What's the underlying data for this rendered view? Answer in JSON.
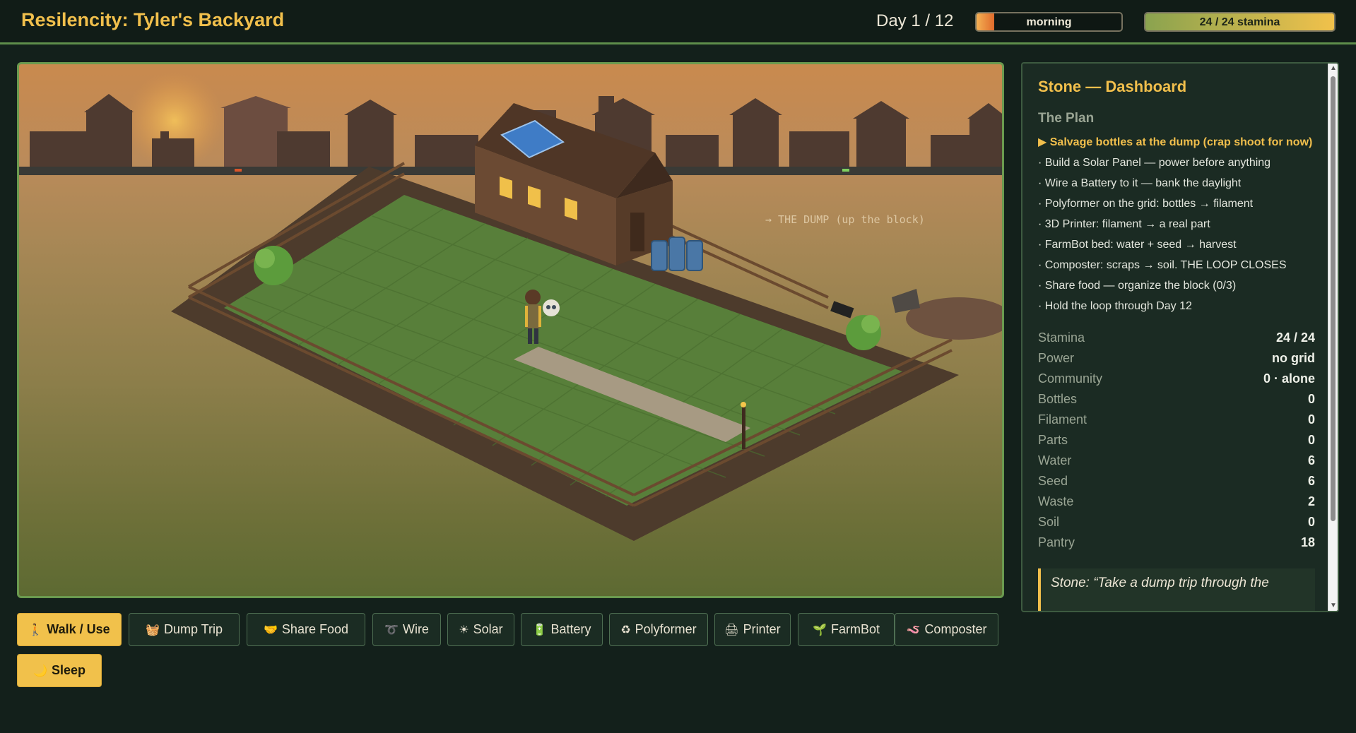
{
  "header": {
    "title": "Resilencity: Tyler's Backyard",
    "day": "Day 1 / 12",
    "time_of_day": {
      "label": "morning",
      "progress": 0.12
    },
    "stamina": {
      "label": "24 / 24 stamina",
      "progress": 1.0
    }
  },
  "scene": {
    "dump_label": "→ THE DUMP (up the block)"
  },
  "dashboard": {
    "title": "Stone — Dashboard",
    "plan_title": "The Plan",
    "plan_items": [
      {
        "text": "▶ Salvage bottles at the dump (crap shoot for now)",
        "active": true
      },
      {
        "text": "· Build a Solar Panel — power before anything",
        "active": false
      },
      {
        "text": "· Wire a Battery to it — bank the daylight",
        "active": false
      },
      {
        "text": "· Polyformer on the grid: bottles → filament",
        "active": false
      },
      {
        "text": "· 3D Printer: filament → a real part",
        "active": false
      },
      {
        "text": "· FarmBot bed: water + seed → harvest",
        "active": false
      },
      {
        "text": "· Composter: scraps → soil. THE LOOP CLOSES",
        "active": false
      },
      {
        "text": "· Share food — organize the block (0/3)",
        "active": false
      },
      {
        "text": "· Hold the loop through Day 12",
        "active": false
      }
    ],
    "stats": [
      {
        "label": "Stamina",
        "value": "24 / 24"
      },
      {
        "label": "Power",
        "value": "no grid"
      },
      {
        "label": "Community",
        "value": "0 · alone"
      },
      {
        "label": "Bottles",
        "value": "0"
      },
      {
        "label": "Filament",
        "value": "0"
      },
      {
        "label": "Parts",
        "value": "0"
      },
      {
        "label": "Water",
        "value": "6"
      },
      {
        "label": "Seed",
        "value": "6"
      },
      {
        "label": "Waste",
        "value": "2"
      },
      {
        "label": "Soil",
        "value": "0"
      },
      {
        "label": "Pantry",
        "value": "18"
      }
    ],
    "quote": "Stone: “Take a dump trip through the"
  },
  "actions": [
    {
      "icon": "🚶",
      "icon_name": "walk-icon",
      "label": "Walk / Use",
      "primary": true
    },
    {
      "icon": "🧺",
      "icon_name": "basket-icon",
      "label": "Dump Trip",
      "primary": false
    },
    {
      "icon": "🤝",
      "icon_name": "handshake-icon",
      "label": "Share Food",
      "primary": false
    },
    {
      "icon": "➰",
      "icon_name": "wire-icon",
      "label": "Wire",
      "primary": false
    },
    {
      "icon": "☀",
      "icon_name": "sun-icon",
      "label": "Solar",
      "primary": false
    },
    {
      "icon": "🔋",
      "icon_name": "battery-icon",
      "label": "Battery",
      "primary": false
    },
    {
      "icon": "♻",
      "icon_name": "recycle-icon",
      "label": "Polyformer",
      "primary": false
    },
    {
      "icon": "🖨",
      "icon_name": "printer-icon",
      "label": "Printer",
      "primary": false
    },
    {
      "icon": "🌱",
      "icon_name": "seedling-icon",
      "label": "FarmBot",
      "primary": false
    },
    {
      "icon": "🪱",
      "icon_name": "worm-icon",
      "label": "Composter",
      "primary": false
    },
    {
      "icon": "🌙",
      "icon_name": "moon-icon",
      "label": "Sleep",
      "primary": true
    }
  ]
}
